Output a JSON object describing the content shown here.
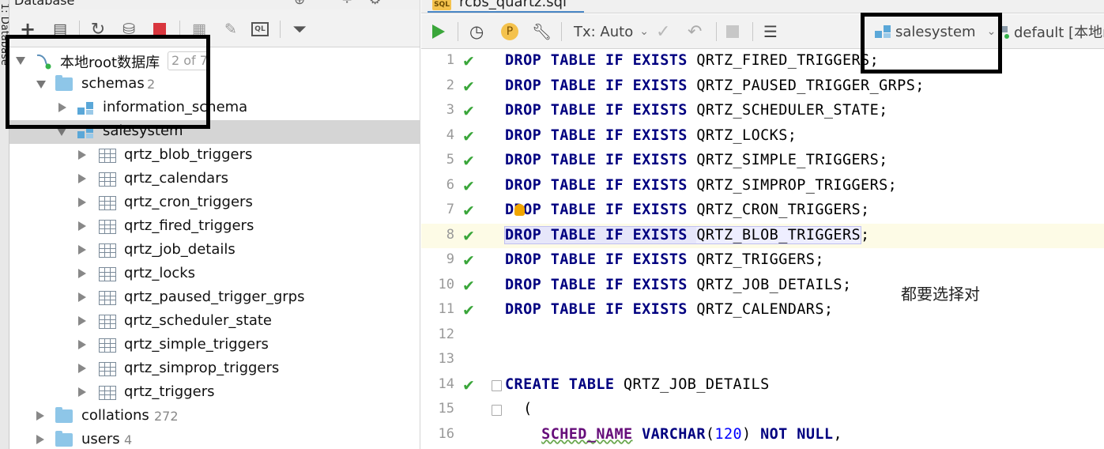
{
  "side_strip": {
    "label": "1: Database"
  },
  "db_panel": {
    "title": "Database",
    "toolbar": {
      "add_icon": "plus-icon",
      "copy_icon": "copy-icon",
      "refresh_icon": "refresh-icon",
      "db_settings_icon": "database-settings-icon",
      "stop_icon": "stop-icon",
      "table_icon": "table-view-icon",
      "edit_icon": "edit-icon",
      "console_icon": "ql-console-icon",
      "filter_icon": "filter-icon"
    },
    "tree": {
      "root": {
        "label": "本地root数据库",
        "badge": "2 of 7"
      },
      "schemas": {
        "label": "schemas",
        "count": "2"
      },
      "schema_items": [
        {
          "label": "information_schema"
        },
        {
          "label": "salesystem"
        }
      ],
      "tables": [
        "qrtz_blob_triggers",
        "qrtz_calendars",
        "qrtz_cron_triggers",
        "qrtz_fired_triggers",
        "qrtz_job_details",
        "qrtz_locks",
        "qrtz_paused_trigger_grps",
        "qrtz_scheduler_state",
        "qrtz_simple_triggers",
        "qrtz_simprop_triggers",
        "qrtz_triggers"
      ],
      "collations": {
        "label": "collations",
        "count": "272"
      },
      "users": {
        "label": "users",
        "count": "4"
      }
    }
  },
  "editor": {
    "tab": {
      "name": "rcbs_quartz.sql",
      "icon_text": "SQL"
    },
    "toolbar": {
      "tx_label": "Tx: Auto",
      "schema_selector": "salesystem",
      "datasource_label": "default [本地root"
    },
    "lines": [
      {
        "n": "1",
        "check": true
      },
      {
        "n": "2",
        "check": true
      },
      {
        "n": "3",
        "check": true
      },
      {
        "n": "4",
        "check": true
      },
      {
        "n": "5",
        "check": true
      },
      {
        "n": "6",
        "check": true
      },
      {
        "n": "7",
        "check": true
      },
      {
        "n": "8",
        "check": true
      },
      {
        "n": "9",
        "check": true
      },
      {
        "n": "10",
        "check": true
      },
      {
        "n": "11",
        "check": true
      },
      {
        "n": "12",
        "check": false
      },
      {
        "n": "13",
        "check": false
      },
      {
        "n": "14",
        "check": true
      },
      {
        "n": "15",
        "check": false
      },
      {
        "n": "16",
        "check": false
      }
    ],
    "sql": {
      "kw_drop": "DROP",
      "kw_table": "TABLE",
      "kw_if": "IF",
      "kw_exists": "EXISTS",
      "kw_create": "CREATE",
      "kw_varchar": "VARCHAR",
      "kw_not": "NOT",
      "kw_null": "NULL",
      "drop_targets": [
        "QRTZ_FIRED_TRIGGERS",
        "QRTZ_PAUSED_TRIGGER_GRPS",
        "QRTZ_SCHEDULER_STATE",
        "QRTZ_LOCKS",
        "QRTZ_SIMPLE_TRIGGERS",
        "QRTZ_SIMPROP_TRIGGERS",
        "QRTZ_CRON_TRIGGERS",
        "QRTZ_BLOB_TRIGGERS",
        "QRTZ_TRIGGERS",
        "QRTZ_JOB_DETAILS",
        "QRTZ_CALENDARS"
      ],
      "create_target": "QRTZ_JOB_DETAILS",
      "paren_open": "(",
      "column_name": "SCHED_NAME",
      "column_len": "120",
      "semicolon": ";"
    },
    "note": "都要选择对"
  },
  "colors": {
    "keyword": "#000080",
    "number": "#0000ff",
    "check": "#3aa63a",
    "selected_row": "#d5d5d5",
    "caret_line": "#fdfbe6"
  }
}
